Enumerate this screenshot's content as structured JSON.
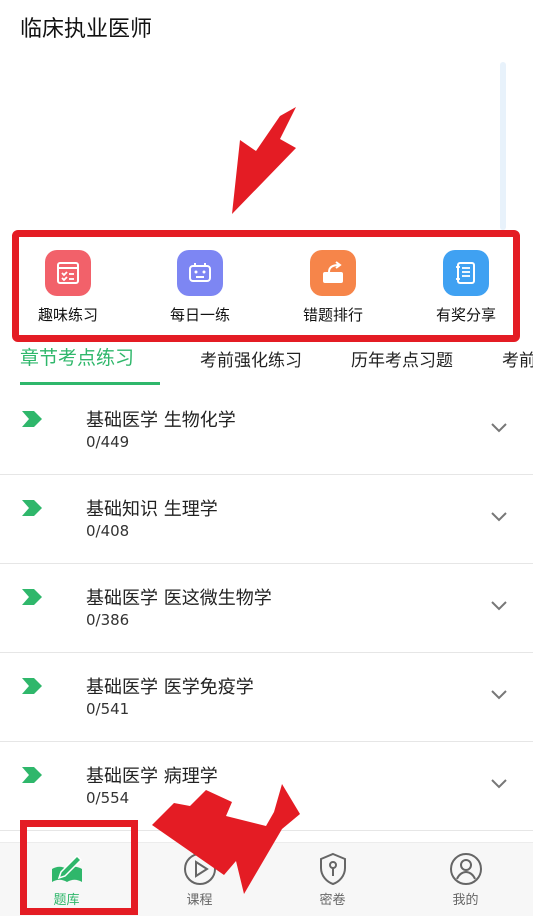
{
  "header": {
    "title": "临床执业医师"
  },
  "quick_menu": [
    {
      "label": "趣味练习",
      "icon": "checklist-icon",
      "color": "#f2616a"
    },
    {
      "label": "每日一练",
      "icon": "robot-icon",
      "color": "#7d86f3"
    },
    {
      "label": "错题排行",
      "icon": "share-box-icon",
      "color": "#f6854a"
    },
    {
      "label": "有奖分享",
      "icon": "notebook-icon",
      "color": "#3fa1f2"
    }
  ],
  "tabs": [
    {
      "label": "章节考点练习",
      "active": true
    },
    {
      "label": "考前强化练习",
      "active": false
    },
    {
      "label": "历年考点习题",
      "active": false
    },
    {
      "label": "考前",
      "active": false
    }
  ],
  "chapters": [
    {
      "title": "基础医学 生物化学",
      "progress": "0/449"
    },
    {
      "title": "基础知识 生理学",
      "progress": "0/408"
    },
    {
      "title": "基础医学 医这微生物学",
      "progress": "0/386"
    },
    {
      "title": "基础医学 医学免疫学",
      "progress": "0/541"
    },
    {
      "title": "基础医学 病理学",
      "progress": "0/554"
    }
  ],
  "bottom_nav": [
    {
      "label": "题库",
      "icon": "question-bank-icon",
      "active": true
    },
    {
      "label": "课程",
      "icon": "play-circle-icon",
      "active": false
    },
    {
      "label": "密卷",
      "icon": "shield-key-icon",
      "active": false
    },
    {
      "label": "我的",
      "icon": "user-icon",
      "active": false
    }
  ],
  "colors": {
    "accent": "#2fb76b",
    "highlight": "#e41c24"
  }
}
